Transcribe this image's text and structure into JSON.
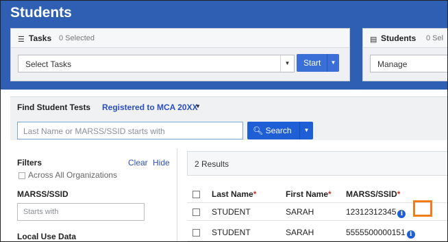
{
  "page": {
    "title": "Students"
  },
  "tasks_panel": {
    "title": "Tasks",
    "count": "0 Selected",
    "select_value": "Select Tasks",
    "start_label": "Start"
  },
  "students_panel": {
    "title": "Students",
    "count": "0 Sel",
    "select_value": "Manage"
  },
  "find": {
    "title": "Find Student Tests",
    "registration_link": "Registered to MCA 20XX",
    "search_placeholder": "Last Name or MARSS/SSID starts with",
    "search_label": "Search"
  },
  "filters": {
    "title": "Filters",
    "clear_label": "Clear",
    "hide_label": "Hide",
    "across_orgs_label": "Across All Organizations",
    "marss_heading": "MARSS/SSID",
    "marss_placeholder": "Starts with",
    "local_use_heading": "Local Use Data"
  },
  "results": {
    "count_text": "2 Results",
    "columns": [
      "Last Name",
      "First Name",
      "MARSS/SSID"
    ],
    "required_mark": "*",
    "rows": [
      {
        "last": "STUDENT",
        "first": "SARAH",
        "id": "12312312345"
      },
      {
        "last": "STUDENT",
        "first": "SARAH",
        "id": "5555500000151"
      }
    ]
  },
  "colors": {
    "header_blue": "#2f5fb3",
    "button_blue": "#1f5fd6",
    "highlight_orange": "#f07c1a",
    "required_red": "#c0392b"
  },
  "icons": {
    "tasks": "list-icon",
    "students": "card-icon",
    "search": "magnifier-icon",
    "info": "info-circle-icon"
  }
}
